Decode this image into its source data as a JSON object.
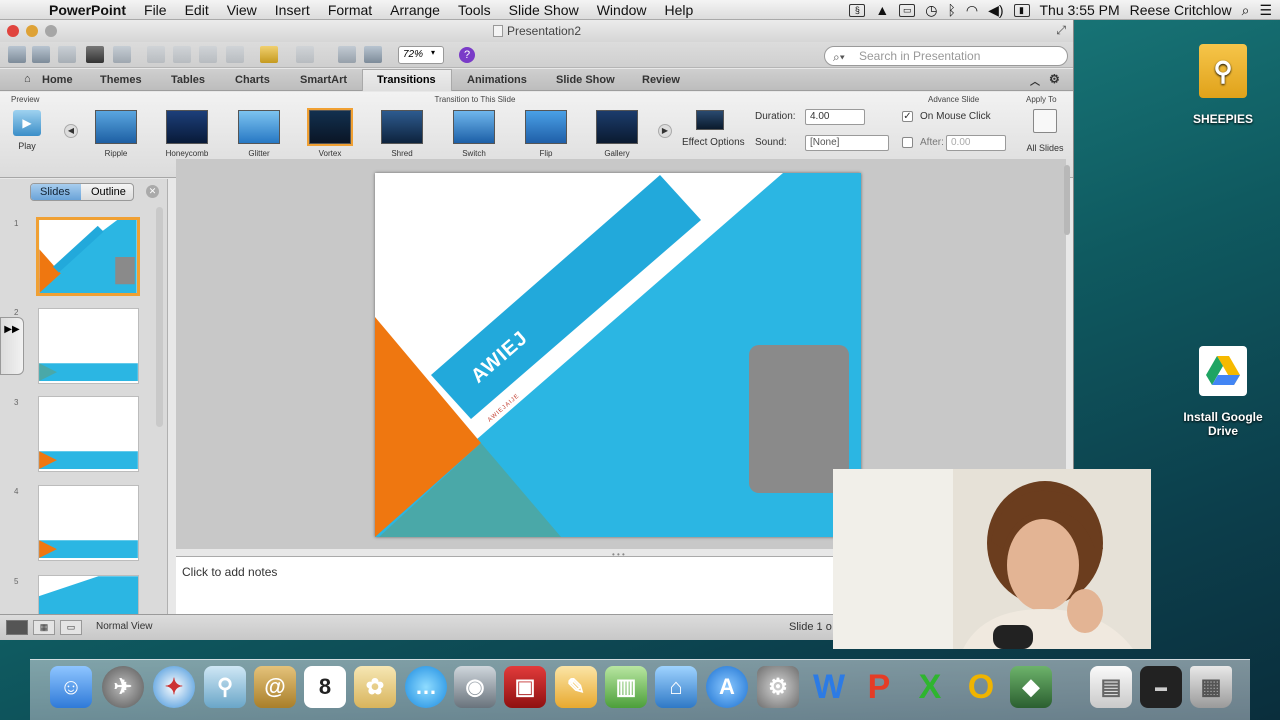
{
  "menubar": {
    "app": "PowerPoint",
    "items": [
      "File",
      "Edit",
      "View",
      "Insert",
      "Format",
      "Arrange",
      "Tools",
      "Slide Show",
      "Window",
      "Help"
    ],
    "clock": "Thu 3:55 PM",
    "user": "Reese Critchlow"
  },
  "window": {
    "title": "Presentation2",
    "zoom": "72%",
    "search_placeholder": "Search in Presentation"
  },
  "tabs": [
    "Home",
    "Themes",
    "Tables",
    "Charts",
    "SmartArt",
    "Transitions",
    "Animations",
    "Slide Show",
    "Review"
  ],
  "ribbon": {
    "preview_label": "Preview",
    "play_label": "Play",
    "group_title": "Transition to This Slide",
    "transitions": [
      "Ripple",
      "Honeycomb",
      "Glitter",
      "Vortex",
      "Shred",
      "Switch",
      "Flip",
      "Gallery"
    ],
    "effect_options": "Effect Options",
    "duration_label": "Duration:",
    "duration_value": "4.00",
    "sound_label": "Sound:",
    "sound_value": "[None]",
    "advance_title": "Advance Slide",
    "on_click_label": "On Mouse Click",
    "after_label": "After:",
    "after_value": "0.00",
    "apply_title": "Apply To",
    "all_slides": "All Slides"
  },
  "slides_pane": {
    "slides_tab": "Slides",
    "outline_tab": "Outline",
    "numbers": [
      "1",
      "2",
      "3",
      "4",
      "5"
    ]
  },
  "slide": {
    "title_text": "AWIEJ",
    "subtitle_text": "AWIEJAIJE",
    "colors": {
      "blue": "#2bb6e3",
      "orange": "#ef7710",
      "teal": "#4aa8a8",
      "gray": "#8a8a8a"
    }
  },
  "notes": {
    "placeholder": "Click to add notes"
  },
  "status": {
    "view": "Normal View",
    "slide_of": "Slide 1 o"
  },
  "desktop": {
    "drive": "SHEEPIES",
    "gdrive": "Install Google Drive"
  },
  "dock": [
    "Finder",
    "Launchpad",
    "Safari",
    "Preview",
    "Contacts",
    "Calendar",
    "Photos",
    "Messages",
    "FaceTime",
    "Photo Booth",
    "Pages",
    "Numbers",
    "Keynote",
    "App Store",
    "System Preferences",
    "Word",
    "PowerPoint",
    "Excel",
    "Outlook",
    "Migration",
    "Downloads",
    "Terminal",
    "Trash"
  ]
}
